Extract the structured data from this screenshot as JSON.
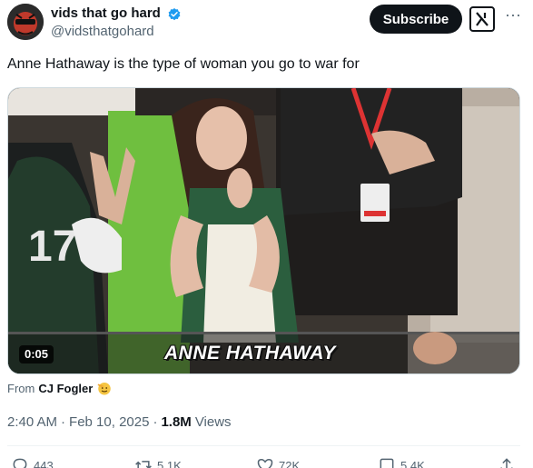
{
  "post": {
    "display_name": "vids that go hard",
    "handle": "@vidsthatgohard",
    "subscribe_label": "Subscribe",
    "more_label": "···",
    "text": "Anne Hathaway is the type of woman you go to war for",
    "video": {
      "duration": "0:05",
      "caption": "ANNE HATHAWAY"
    },
    "from_label": "From",
    "from_name": "CJ Fogler",
    "time": "2:40 AM",
    "separator_1": "·",
    "date": "Feb 10, 2025",
    "separator_2": "·",
    "views_count": "1.8M",
    "views_label": "Views"
  },
  "actions": {
    "replies": "443",
    "reposts": "5.1K",
    "likes": "72K",
    "bookmarks": "5.4K"
  },
  "icons": {
    "verified": "verified-badge-icon",
    "grok": "grok-icon",
    "reply": "reply-icon",
    "repost": "repost-icon",
    "like": "heart-icon",
    "bookmark": "bookmark-icon",
    "share": "share-icon"
  },
  "colors": {
    "verified_blue": "#1d9bf0",
    "text_primary": "#0f1419",
    "text_secondary": "#536471"
  }
}
